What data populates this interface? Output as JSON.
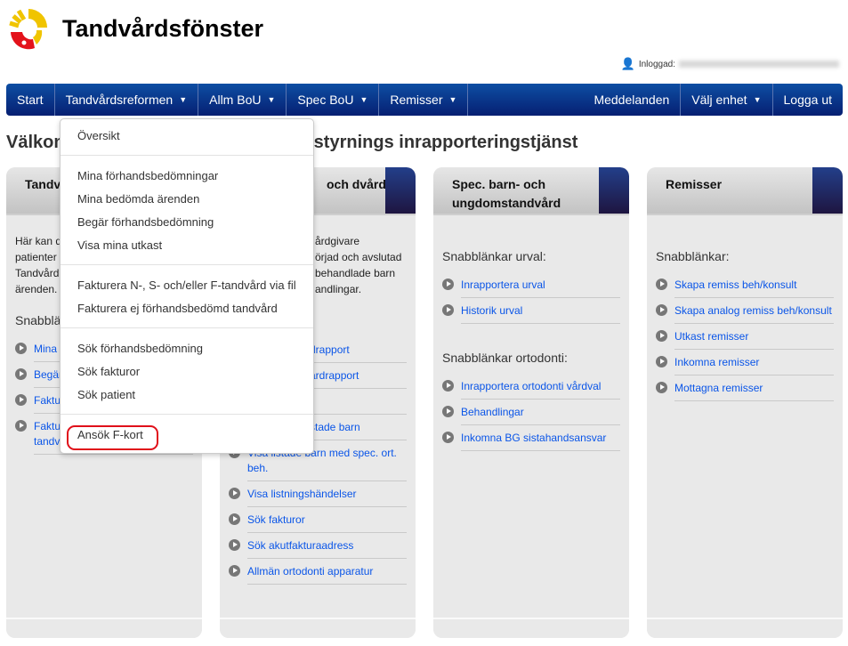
{
  "header": {
    "brand": "Tandvårdsfönster",
    "login_label": "Inloggad:"
  },
  "nav": {
    "items": [
      "Start",
      "Tandvårdsreformen",
      "Allm BoU",
      "Spec BoU",
      "Remisser"
    ],
    "right": [
      "Meddelanden",
      "Välj enhet",
      "Logga ut"
    ]
  },
  "page": {
    "title_start": "Välkom",
    "title_end": "isstyrnings inrapporteringstjänst"
  },
  "cards": [
    {
      "title": "Tandv",
      "desc": [
        "Här kan d",
        "patienter",
        "Tandvård",
        "ärenden."
      ],
      "sections": [
        {
          "label": "Snabblä",
          "links": [
            "Mina s",
            "Begär",
            "Faktur tandvå",
            "Fakturera N-, S- och/eller F-tandvård via fil"
          ]
        }
      ]
    },
    {
      "title": "och dvård",
      "desc": [
        "årdgivare",
        "örjad och avslutad",
        "behandlade barn",
        "andlingar."
      ],
      "sections": [
        {
          "label": "",
          "links": [
            "drapport",
            "ärdrapport",
            "",
            "stade barn",
            "Visa listade barn med spec. ort. beh.",
            "Visa listningshändelser",
            "Sök fakturor",
            "Sök akutfakturaadress",
            "Allmän ortodonti apparatur"
          ]
        }
      ]
    },
    {
      "title": "Spec. barn- och ungdomstandvård",
      "desc": [],
      "sections": [
        {
          "label": "Snabblänkar urval:",
          "links": [
            "Inrapportera urval",
            "Historik urval"
          ]
        },
        {
          "label": "Snabblänkar ortodonti:",
          "links": [
            "Inrapportera ortodonti vårdval",
            "Behandlingar",
            "Inkomna BG sistahandsansvar"
          ]
        }
      ]
    },
    {
      "title": "Remisser",
      "desc": [],
      "sections": [
        {
          "label": "Snabblänkar:",
          "links": [
            "Skapa remiss beh/konsult",
            "Skapa analog remiss beh/konsult",
            "Utkast remisser",
            "Inkomna remisser",
            "Mottagna remisser"
          ]
        }
      ]
    }
  ],
  "dropdown": {
    "groups": [
      [
        "Översikt"
      ],
      [
        "Mina förhandsbedömningar",
        "Mina bedömda ärenden",
        "Begär förhandsbedömning",
        "Visa mina utkast"
      ],
      [
        "Fakturera N-, S- och/eller F-tandvård via fil",
        "Fakturera ej förhandsbedömd tandvård"
      ],
      [
        "Sök förhandsbedömning",
        "Sök fakturor",
        "Sök patient"
      ],
      [
        "Ansök F-kort"
      ]
    ],
    "highlighted": "Ansök F-kort"
  },
  "colors": {
    "nav": "#0a3a8f",
    "link": "#0a55e8",
    "highlight": "#e0101a"
  }
}
